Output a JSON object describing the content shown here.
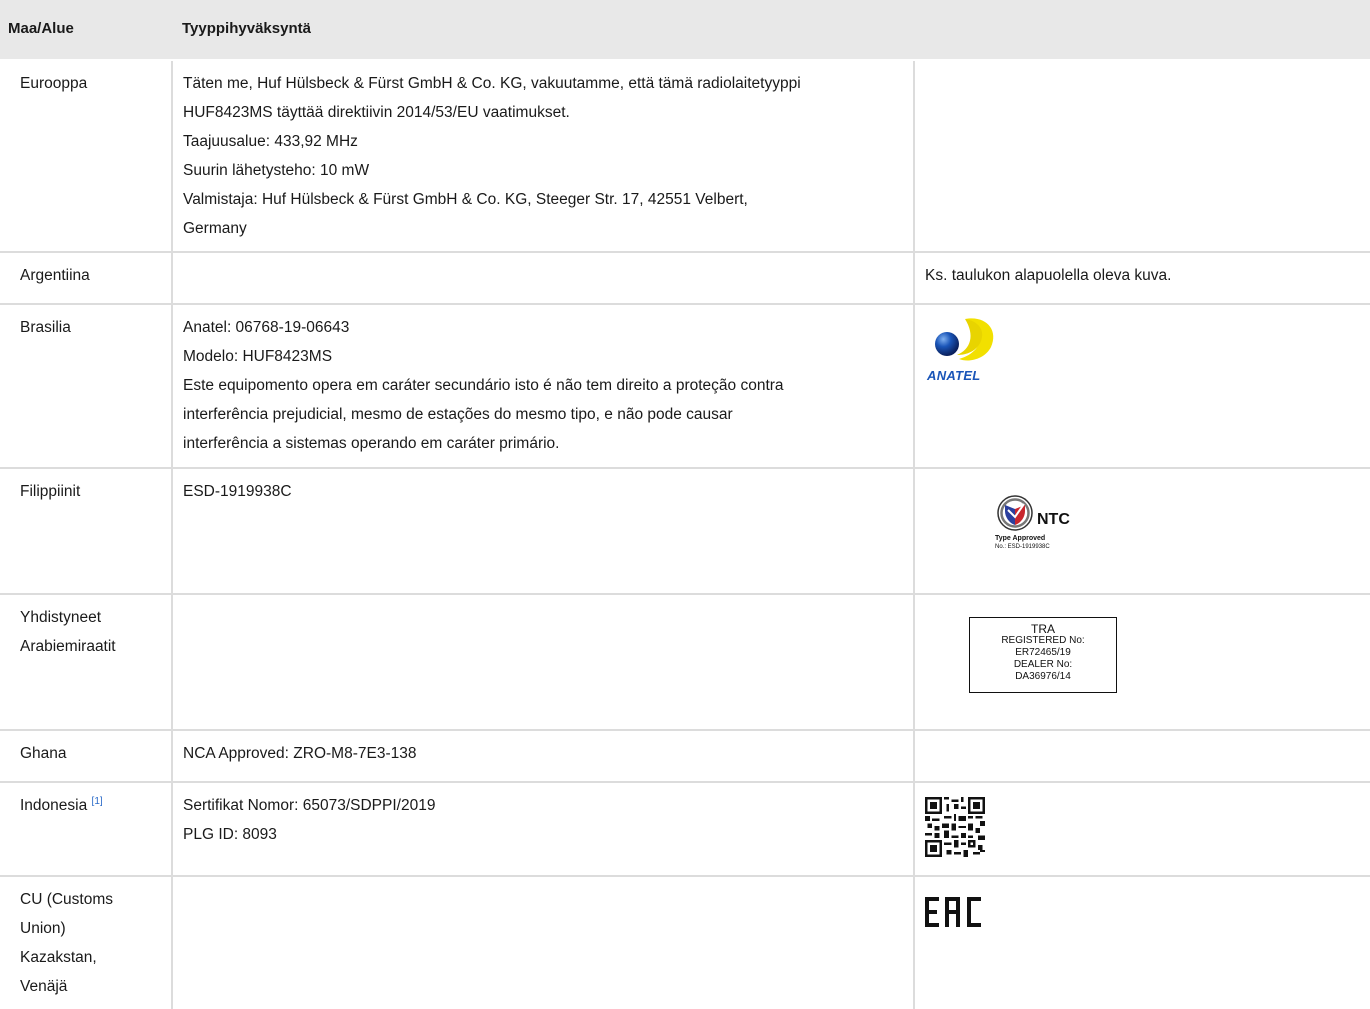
{
  "table": {
    "headers": {
      "region": "Maa/Alue",
      "approval": "Tyyppihyväksyntä",
      "mark": ""
    },
    "rows": [
      {
        "region": [
          "Eurooppa"
        ],
        "text": [
          "Täten me, Huf Hülsbeck & Fürst GmbH & Co. KG, vakuutamme, että tämä radiolaitetyyppi",
          "HUF8423MS täyttää direktiivin 2014/53/EU vaatimukset.",
          "Taajuusalue: 433,92 MHz",
          "Suurin lähetysteho: 10 mW",
          "Valmistaja: Huf Hülsbeck & Fürst GmbH & Co. KG, Steeger Str. 17, 42551 Velbert,",
          "Germany"
        ],
        "mark_text": ""
      },
      {
        "region": [
          "Argentiina"
        ],
        "text": [],
        "mark_text": "Ks. taulukon alapuolella oleva kuva."
      },
      {
        "region": [
          "Brasilia"
        ],
        "text": [
          "Anatel: 06768-19-06643",
          "Modelo: HUF8423MS",
          "Este equipomento opera em caráter secundário isto é não tem direito a proteção contra",
          "interferência prejudicial, mesmo de estações do mesmo tipo, e não pode causar",
          "interferência a sistemas operando em caráter primário."
        ],
        "logo": {
          "type": "anatel-logo",
          "label": "ANATEL",
          "colors": {
            "blue": "#1a55b8",
            "yellow": "#f2e000"
          }
        }
      },
      {
        "region": [
          "Filippiinit"
        ],
        "text": [
          "ESD-1919938C"
        ],
        "logo": {
          "type": "ntc-logo",
          "label": "NTC",
          "sub1": "Type Approved",
          "sub2": "No.: ESD-1919938C",
          "colors": {
            "blue": "#2b3f9e",
            "red": "#c8262d"
          }
        }
      },
      {
        "region": [
          "Yhdistyneet",
          "Arabiemiraatit"
        ],
        "text": [],
        "logo": {
          "type": "tra-label",
          "lines": [
            "TRA",
            "REGISTERED No:",
            "ER72465/19",
            "DEALER No:",
            "DA36976/14"
          ]
        }
      },
      {
        "region": [
          "Ghana"
        ],
        "text": [
          "NCA Approved: ZRO-M8-7E3-138"
        ],
        "mark_text": ""
      },
      {
        "region": [
          "Indonesia"
        ],
        "region_ref": "[1]",
        "text": [
          "Sertifikat Nomor: 65073/SDPPI/2019",
          "PLG ID: 8093"
        ],
        "logo": {
          "type": "qr-code-icon"
        }
      },
      {
        "region": [
          "CU (Customs",
          "Union)",
          "Kazakstan,",
          "Venäjä"
        ],
        "text": [],
        "logo": {
          "type": "eac-logo"
        }
      }
    ]
  }
}
